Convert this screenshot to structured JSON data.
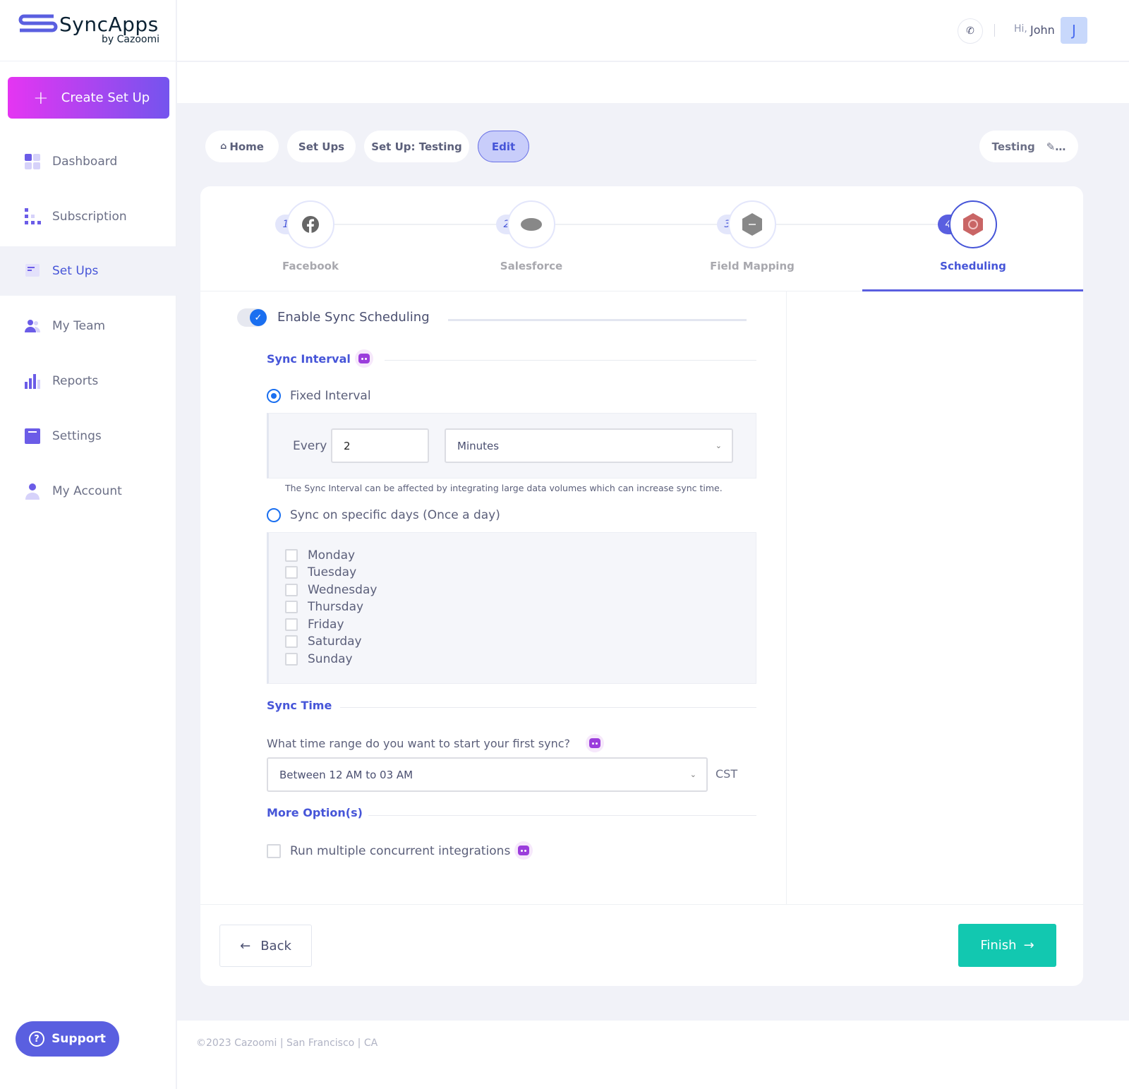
{
  "brand": {
    "name": "SyncApps",
    "byline": "by Cazoomi",
    "accent": "#4655d8"
  },
  "sidebar": {
    "create_label": "Create Set Up",
    "items": [
      {
        "label": "Dashboard",
        "icon": "dashboard-icon"
      },
      {
        "label": "Subscription",
        "icon": "subscription-icon"
      },
      {
        "label": "Set Ups",
        "icon": "setups-icon",
        "active": true
      },
      {
        "label": "My Team",
        "icon": "team-icon"
      },
      {
        "label": "Reports",
        "icon": "reports-icon"
      },
      {
        "label": "Settings",
        "icon": "settings-icon"
      },
      {
        "label": "My Account",
        "icon": "account-icon"
      }
    ],
    "support_label": "Support"
  },
  "header": {
    "greeting": "Hi,",
    "user": "John",
    "avatar_initial": "J"
  },
  "breadcrumb": [
    "Home",
    "Set Ups",
    "Set Up: Testing",
    "Edit"
  ],
  "setup_name": "Testing",
  "steps": [
    {
      "num": "1",
      "label": "Facebook"
    },
    {
      "num": "2",
      "label": "Salesforce"
    },
    {
      "num": "3",
      "label": "Field Mapping"
    },
    {
      "num": "4",
      "label": "Scheduling",
      "active": true
    }
  ],
  "form": {
    "enable_label": "Enable Sync Scheduling",
    "enabled": true,
    "sync_interval_title": "Sync Interval",
    "fixed_label": "Fixed Interval",
    "fixed_selected": true,
    "every_label": "Every",
    "every_value": "2",
    "unit": "Minutes",
    "interval_note": "The Sync Interval can be affected by integrating large data volumes which can increase sync time.",
    "days_label": "Sync on specific days (Once a day)",
    "days": [
      "Monday",
      "Tuesday",
      "Wednesday",
      "Thursday",
      "Friday",
      "Saturday",
      "Sunday"
    ],
    "sync_time_title": "Sync Time",
    "time_question": "What time range do you want to start your first sync?",
    "time_range": "Between 12 AM to 03 AM",
    "timezone": "CST",
    "more_title": "More Option(s)",
    "concurrent_label": "Run multiple concurrent integrations"
  },
  "actions": {
    "back": "Back",
    "finish": "Finish"
  },
  "footer": "©2023 Cazoomi | San Francisco | CA"
}
